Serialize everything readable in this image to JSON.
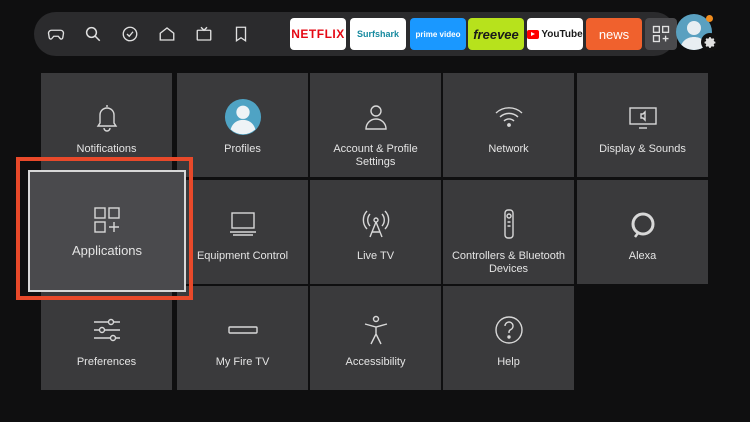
{
  "nav": {
    "icons": [
      "gamepad-icon",
      "search-icon",
      "check-circle-icon",
      "home-icon",
      "tv-icon",
      "bookmark-icon"
    ]
  },
  "apps": [
    {
      "label": "NETFLIX",
      "name": "netflix",
      "bg": "#ffffff",
      "fg": "#e50914"
    },
    {
      "label": "Surfshark",
      "name": "surfshark",
      "bg": "#ffffff",
      "fg": "#178a9f"
    },
    {
      "label": "prime video",
      "name": "prime-video",
      "bg": "#1a98ff",
      "fg": "#ffffff"
    },
    {
      "label": "freevee",
      "name": "freevee",
      "bg": "#b7e21c",
      "fg": "#1a1a1a"
    },
    {
      "label": "YouTube",
      "name": "youtube",
      "bg": "#ffffff",
      "fg": "#1a1a1a"
    },
    {
      "label": "news",
      "name": "news",
      "bg": "#f0612d",
      "fg": "#ffffff"
    }
  ],
  "settings": [
    {
      "label": "Notifications",
      "icon": "bell-icon"
    },
    {
      "label": "Profiles",
      "icon": "profile-avatar-icon"
    },
    {
      "label": "Account & Profile Settings",
      "icon": "person-icon"
    },
    {
      "label": "Network",
      "icon": "wifi-icon"
    },
    {
      "label": "Display & Sounds",
      "icon": "display-sound-icon"
    },
    {
      "label": "Applications",
      "icon": "apps-icon",
      "selected": true
    },
    {
      "label": "Equipment Control",
      "icon": "monitor-icon"
    },
    {
      "label": "Live TV",
      "icon": "antenna-icon"
    },
    {
      "label": "Controllers & Bluetooth Devices",
      "icon": "remote-icon"
    },
    {
      "label": "Alexa",
      "icon": "alexa-icon"
    },
    {
      "label": "Preferences",
      "icon": "sliders-icon"
    },
    {
      "label": "My Fire TV",
      "icon": "fire-tv-device-icon"
    },
    {
      "label": "Accessibility",
      "icon": "accessibility-icon"
    },
    {
      "label": "Help",
      "icon": "help-icon"
    }
  ],
  "colors": {
    "highlight": "#e8492a",
    "tile": "#3a3a3c",
    "topbar": "#2b2b2d"
  }
}
